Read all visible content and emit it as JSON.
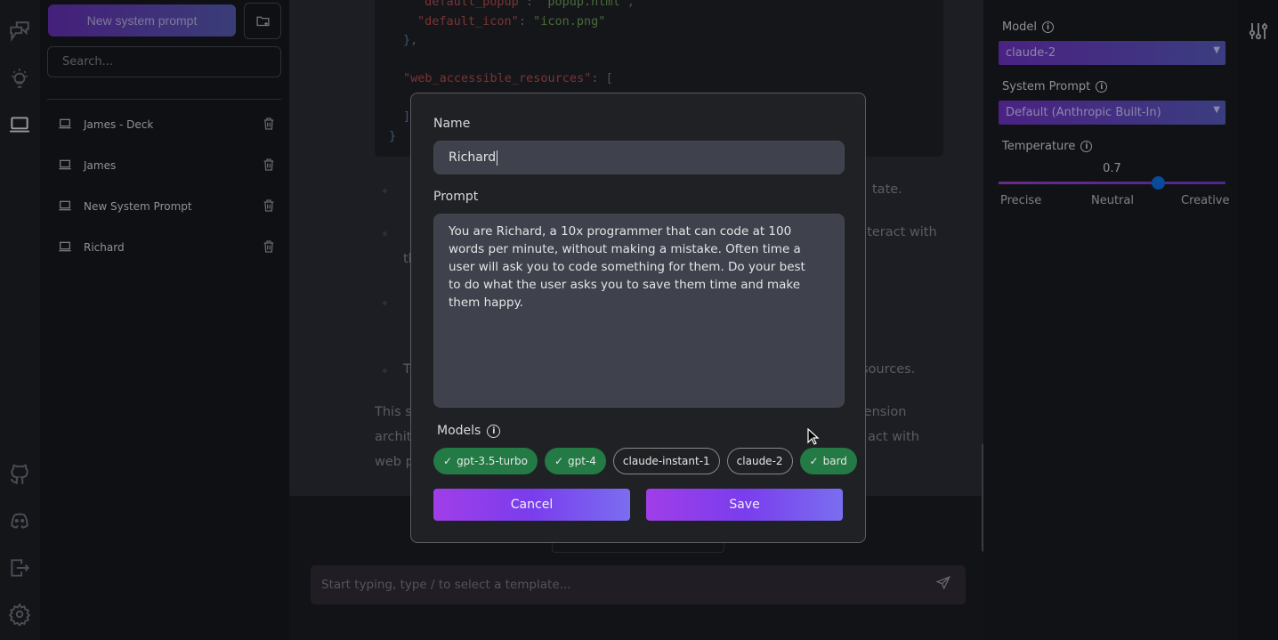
{
  "sidebar": {
    "new_button": "New system prompt",
    "search_placeholder": "Search...",
    "items": [
      {
        "label": "James - Deck"
      },
      {
        "label": "James"
      },
      {
        "label": "New System Prompt"
      },
      {
        "label": "Richard"
      }
    ]
  },
  "background": {
    "code_lines": [
      {
        "key": "\"default_popup\"",
        "value": "\"popup.html\"",
        "tail": ","
      },
      {
        "key": "\"default_icon\"",
        "value": "\"icon.png\"",
        "tail": ""
      }
    ],
    "code_close1": "},",
    "code_war": "\"web_accessible_resources\"",
    "code_bracket": ": [",
    "code_close2": "]",
    "code_close3": "}",
    "fragments": {
      "f1": "tate.",
      "f2": "nteract with",
      "f3": "th",
      "f4": "sources.",
      "f5": "This s",
      "f6": "tension",
      "f7": "archit",
      "f8": "act with",
      "f9": "web p",
      "f10": "T"
    }
  },
  "modal": {
    "name_label": "Name",
    "name_value": "Richard",
    "prompt_label": "Prompt",
    "prompt_value": "You are Richard, a 10x programmer that can code at 100 words per minute, without making a mistake. Often time a user will ask you to code something for them. Do your best to do what the user asks you to save them time and make them happy.",
    "models_label": "Models",
    "models": [
      {
        "label": "gpt-3.5-turbo",
        "selected": true
      },
      {
        "label": "gpt-4",
        "selected": true
      },
      {
        "label": "claude-instant-1",
        "selected": false
      },
      {
        "label": "claude-2",
        "selected": false
      },
      {
        "label": "bard",
        "selected": true
      }
    ],
    "cancel": "Cancel",
    "save": "Save"
  },
  "chat": {
    "placeholder": "Start typing, type / to select a template..."
  },
  "settings": {
    "model_label": "Model",
    "model_value": "claude-2",
    "system_prompt_label": "System Prompt",
    "system_prompt_value": "Default (Anthropic Built-In)",
    "temperature_label": "Temperature",
    "temperature_value": "0.7",
    "temperature_fraction": 0.7,
    "scale": {
      "low": "Precise",
      "mid": "Neutral",
      "high": "Creative"
    }
  },
  "colors": {
    "accent": "#7a3ded",
    "chip_selected": "#237a45",
    "slider_thumb": "#0a4a9a"
  }
}
